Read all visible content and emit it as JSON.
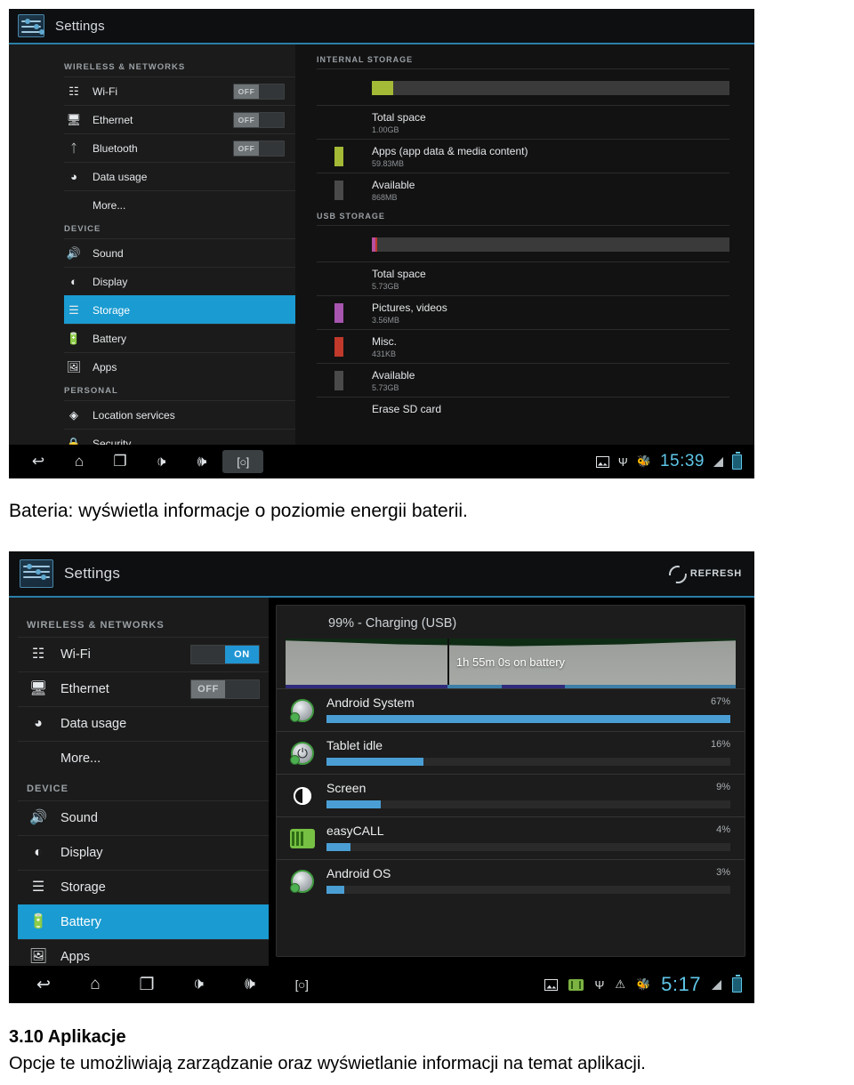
{
  "document": {
    "caption_battery": "Bateria: wyświetla informacje o poziomie energii baterii.",
    "heading_apps": "3.10 Aplikacje",
    "paragraph_apps": "Opcje te umożliwiają zarządzanie oraz wyświetlanie informacji na temat aplikacji."
  },
  "screenshot_storage": {
    "app_title": "Settings",
    "sidebar": {
      "groups": [
        {
          "label": "WIRELESS & NETWORKS",
          "items": [
            {
              "label": "Wi-Fi",
              "icon": "wifi-icon",
              "toggle": "OFF",
              "toggle_state": "off",
              "selected": false
            },
            {
              "label": "Ethernet",
              "icon": "ethernet-icon",
              "toggle": "OFF",
              "toggle_state": "off",
              "selected": false
            },
            {
              "label": "Bluetooth",
              "icon": "bluetooth-icon",
              "toggle": "OFF",
              "toggle_state": "off",
              "selected": false
            },
            {
              "label": "Data usage",
              "icon": "data-usage-icon",
              "toggle": null,
              "selected": false
            },
            {
              "label": "More...",
              "icon": null,
              "toggle": null,
              "selected": false
            }
          ]
        },
        {
          "label": "DEVICE",
          "items": [
            {
              "label": "Sound",
              "icon": "sound-icon",
              "toggle": null,
              "selected": false
            },
            {
              "label": "Display",
              "icon": "display-icon",
              "toggle": null,
              "selected": false
            },
            {
              "label": "Storage",
              "icon": "storage-icon",
              "toggle": null,
              "selected": true
            },
            {
              "label": "Battery",
              "icon": "battery-icon",
              "toggle": null,
              "selected": false
            },
            {
              "label": "Apps",
              "icon": "apps-icon",
              "toggle": null,
              "selected": false
            }
          ]
        },
        {
          "label": "PERSONAL",
          "items": [
            {
              "label": "Location services",
              "icon": "location-icon",
              "toggle": null,
              "selected": false
            },
            {
              "label": "Security",
              "icon": "security-icon",
              "toggle": null,
              "selected": false
            }
          ]
        }
      ]
    },
    "internal_storage": {
      "section_title": "INTERNAL STORAGE",
      "bar_segments": [
        {
          "color": "#a4b935",
          "percent": 6
        }
      ],
      "rows": [
        {
          "title": "Total space",
          "sub": "1.00GB",
          "color": null
        },
        {
          "title": "Apps (app data & media content)",
          "sub": "59.83MB",
          "color": "#a4b935"
        },
        {
          "title": "Available",
          "sub": "868MB",
          "color": "#4a4a4a"
        }
      ]
    },
    "usb_storage": {
      "section_title": "USB STORAGE",
      "bar_segments": [
        {
          "color": "#b84fa0",
          "percent": 1
        },
        {
          "color": "#c0392b",
          "percent": 0.6
        }
      ],
      "rows": [
        {
          "title": "Total space",
          "sub": "5.73GB",
          "color": null
        },
        {
          "title": "Pictures, videos",
          "sub": "3.56MB",
          "color": "#a855b0"
        },
        {
          "title": "Misc.",
          "sub": "431KB",
          "color": "#c0392b"
        },
        {
          "title": "Available",
          "sub": "5.73GB",
          "color": "#4a4a4a"
        },
        {
          "title": "Erase SD card",
          "sub": "",
          "color": null
        }
      ]
    },
    "navbar": {
      "buttons": [
        {
          "name": "back-button",
          "glyph": "↩"
        },
        {
          "name": "home-button",
          "glyph": "⌂"
        },
        {
          "name": "recents-button",
          "glyph": "❐"
        },
        {
          "name": "volume-down-button",
          "glyph": "🕩"
        },
        {
          "name": "volume-up-button",
          "glyph": "🕪"
        },
        {
          "name": "screenshot-button",
          "glyph": "[○]"
        }
      ],
      "status_icons": [
        "screenshot-captured-icon",
        "usb-icon",
        "debug-icon"
      ],
      "clock": "15:39"
    }
  },
  "screenshot_battery": {
    "app_title": "Settings",
    "refresh_label": "REFRESH",
    "sidebar": {
      "groups": [
        {
          "label": "WIRELESS & NETWORKS",
          "items": [
            {
              "label": "Wi-Fi",
              "icon": "wifi-icon",
              "toggle": "ON",
              "toggle_state": "on",
              "selected": false
            },
            {
              "label": "Ethernet",
              "icon": "ethernet-icon",
              "toggle": "OFF",
              "toggle_state": "off",
              "selected": false
            },
            {
              "label": "Data usage",
              "icon": "data-usage-icon",
              "toggle": null,
              "selected": false
            },
            {
              "label": "More...",
              "icon": null,
              "toggle": null,
              "selected": false
            }
          ]
        },
        {
          "label": "DEVICE",
          "items": [
            {
              "label": "Sound",
              "icon": "sound-icon",
              "toggle": null,
              "selected": false
            },
            {
              "label": "Display",
              "icon": "display-icon",
              "toggle": null,
              "selected": false
            },
            {
              "label": "Storage",
              "icon": "storage-icon",
              "toggle": null,
              "selected": false
            },
            {
              "label": "Battery",
              "icon": "battery-icon",
              "toggle": null,
              "selected": true
            },
            {
              "label": "Apps",
              "icon": "apps-icon",
              "toggle": null,
              "selected": false
            }
          ]
        }
      ]
    },
    "battery": {
      "status": "99% - Charging (USB)",
      "graph_label": "1h 55m 0s on battery",
      "usage": [
        {
          "name": "Android System",
          "percent": "67%",
          "value": 67,
          "icon": "android-head-icon"
        },
        {
          "name": "Tablet idle",
          "percent": "16%",
          "value": 16,
          "icon": "power-icon"
        },
        {
          "name": "Screen",
          "percent": "9%",
          "value": 9,
          "icon": "brightness-icon"
        },
        {
          "name": "easyCALL",
          "percent": "4%",
          "value": 4,
          "icon": "easycall-icon"
        },
        {
          "name": "Android OS",
          "percent": "3%",
          "value": 3,
          "icon": "android-head-icon"
        }
      ]
    },
    "navbar": {
      "buttons": [
        {
          "name": "back-button",
          "glyph": "↩"
        },
        {
          "name": "home-button",
          "glyph": "⌂"
        },
        {
          "name": "recents-button",
          "glyph": "❐"
        },
        {
          "name": "volume-down-button",
          "glyph": "🕩"
        },
        {
          "name": "volume-up-button",
          "glyph": "🕪"
        },
        {
          "name": "screenshot-button",
          "glyph": "[○]"
        }
      ],
      "status_icons": [
        "screenshot-captured-icon",
        "sd-card-icon",
        "usb-icon",
        "warning-icon",
        "debug-icon"
      ],
      "clock": "5:17"
    }
  },
  "colors": {
    "accent_blue": "#1a9bd1",
    "bar_blue": "#4a9ed4",
    "clock_blue": "#5fc6e8",
    "apps_green": "#a4b935",
    "pictures_purple": "#a855b0",
    "misc_red": "#c0392b"
  }
}
